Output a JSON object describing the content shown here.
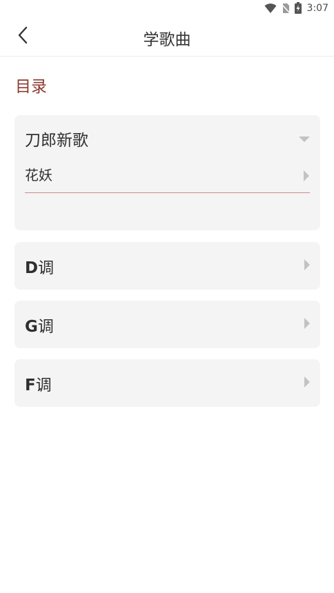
{
  "status_bar": {
    "time": "3:07",
    "icons": [
      "wifi-icon",
      "no-sim-icon",
      "battery-charging-icon"
    ]
  },
  "app_bar": {
    "title": "学歌曲",
    "back_icon": "chevron-left-icon"
  },
  "section": {
    "title": "目录"
  },
  "catalog": {
    "expanded_group": {
      "label": "刀郎新歌",
      "toggle_icon": "caret-down-icon",
      "items": [
        {
          "label": "花妖",
          "icon": "caret-right-icon"
        }
      ]
    },
    "groups": [
      {
        "key": "D",
        "suffix": "调",
        "icon": "caret-right-icon"
      },
      {
        "key": "G",
        "suffix": "调",
        "icon": "caret-right-icon"
      },
      {
        "key": "F",
        "suffix": "调",
        "icon": "caret-right-icon"
      }
    ]
  },
  "colors": {
    "accent": "#8a3b2e",
    "card_bg": "#f4f4f4",
    "divider": "#c98a8a"
  }
}
